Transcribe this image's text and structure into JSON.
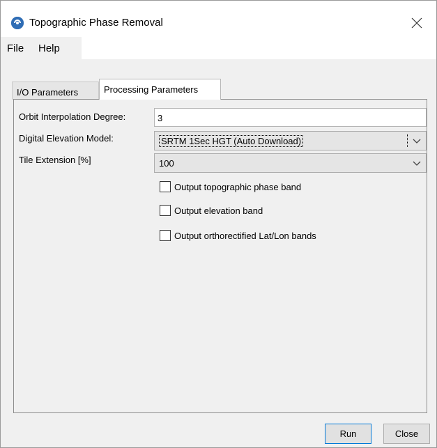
{
  "window": {
    "title": "Topographic Phase Removal",
    "app_icon": "snap-icon",
    "close_icon": "close-icon"
  },
  "menu": {
    "items": [
      "File",
      "Help"
    ]
  },
  "tabs": [
    {
      "label": "I/O Parameters",
      "active": false
    },
    {
      "label": "Processing Parameters",
      "active": true
    }
  ],
  "form": {
    "orbit_label": "Orbit Interpolation Degree:",
    "orbit_value": "3",
    "dem_label": "Digital Elevation Model:",
    "dem_value": "SRTM 1Sec HGT (Auto Download)",
    "tile_label": "Tile Extension [%]",
    "tile_value": "100",
    "checkboxes": [
      {
        "label": "Output topographic phase band",
        "checked": false
      },
      {
        "label": "Output elevation band",
        "checked": false
      },
      {
        "label": "Output orthorectified Lat/Lon bands",
        "checked": false
      }
    ]
  },
  "buttons": {
    "run": "Run",
    "close": "Close"
  },
  "colors": {
    "run_focus_border": "#0078d7",
    "app_icon": "#2f6db5"
  }
}
